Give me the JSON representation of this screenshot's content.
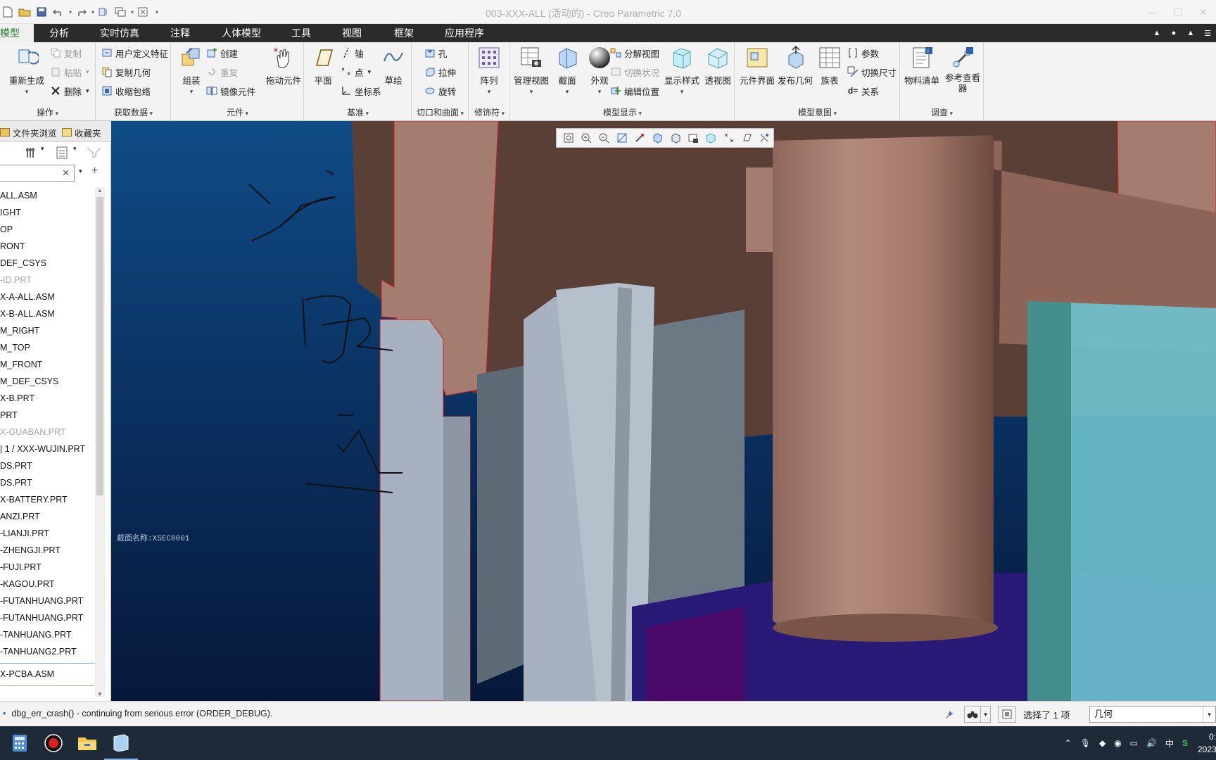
{
  "window": {
    "title": "003-XXX-ALL (活动的) - Creo Parametric 7.0"
  },
  "tabs": [
    {
      "label": "模型",
      "active": true
    },
    {
      "label": "分析"
    },
    {
      "label": "实时仿真"
    },
    {
      "label": "注释"
    },
    {
      "label": "人体模型"
    },
    {
      "label": "工具"
    },
    {
      "label": "视图"
    },
    {
      "label": "框架"
    },
    {
      "label": "应用程序"
    }
  ],
  "ribbon": {
    "operations": {
      "title": "操作",
      "regenerate": "重新生成",
      "copy": "复制",
      "paste": "粘贴",
      "delete": "删除"
    },
    "get_data": {
      "title": "获取数据",
      "udf": "用户定义特征",
      "copy_geometry": "复制几何",
      "shrinkwrap": "收缩包络"
    },
    "component": {
      "title": "元件",
      "assemble": "组装",
      "create": "创建",
      "repeat": "重复",
      "mirror": "镜像元件",
      "drag": "拖动元件"
    },
    "datum": {
      "title": "基准",
      "plane": "平面",
      "axis": "轴",
      "point": "点",
      "csys": "坐标系",
      "sketch": "草绘"
    },
    "cut_surface": {
      "title": "切口和曲面",
      "hole": "孔",
      "extrude": "拉伸",
      "revolve": "旋转"
    },
    "modifiers": {
      "title": "修饰符",
      "pattern": "阵列"
    },
    "model_display": {
      "title": "模型显示",
      "manage_views": "管理视图",
      "section": "截面",
      "appearance": "外观",
      "exploded_view": "分解视图",
      "toggle_status": "切换状况",
      "edit_position": "编辑位置",
      "display_style": "显示样式",
      "perspective": "透视图"
    },
    "model_intent": {
      "title": "模型意图",
      "component_interface": "元件界面",
      "publish_geometry": "发布几何",
      "family_table": "族表",
      "parameters": "参数",
      "switch_dimensions": "切换尺寸",
      "relations": "关系"
    },
    "investigate": {
      "title": "调查",
      "bom": "物料清单",
      "reference_viewer": "参考查看器"
    }
  },
  "navigator": {
    "tabs": [
      "文件夹浏览",
      "收藏夹"
    ],
    "tree": [
      {
        "label": "ALL.ASM"
      },
      {
        "label": "IGHT"
      },
      {
        "label": "OP"
      },
      {
        "label": "RONT"
      },
      {
        "label": "DEF_CSYS"
      },
      {
        "label": "-ID.PRT",
        "dim": true
      },
      {
        "label": "X-A-ALL.ASM"
      },
      {
        "label": "X-B-ALL.ASM"
      },
      {
        "label": "M_RIGHT"
      },
      {
        "label": "M_TOP"
      },
      {
        "label": "M_FRONT"
      },
      {
        "label": "M_DEF_CSYS"
      },
      {
        "label": "X-B.PRT"
      },
      {
        "label": "PRT"
      },
      {
        "label": "X-GUABAN.PRT",
        "dim": true
      },
      {
        "label": "| 1 / XXX-WUJIN.PRT"
      },
      {
        "label": "DS.PRT"
      },
      {
        "label": "DS.PRT"
      },
      {
        "label": "X-BATTERY.PRT"
      },
      {
        "label": "ANZI.PRT"
      },
      {
        "label": "-LIANJI.PRT"
      },
      {
        "label": "-ZHENGJI.PRT"
      },
      {
        "label": "-FUJI.PRT"
      },
      {
        "label": "-KAGOU.PRT"
      },
      {
        "label": "-FUTANHUANG.PRT"
      },
      {
        "label": "-FUTANHUANG.PRT"
      },
      {
        "label": "-TANHUANG.PRT"
      },
      {
        "label": "-TANHUANG2.PRT"
      }
    ],
    "footer_item": "X-PCBA.ASM"
  },
  "viewport": {
    "section_label": "截面名称:XSEC0001"
  },
  "status": {
    "message": "dbg_err_crash() - continuing from serious error (ORDER_DEBUG).",
    "selection": "选择了 1 项",
    "filter": "几何"
  },
  "taskbar": {
    "ime": "中",
    "time": "0:",
    "date": "2023"
  }
}
